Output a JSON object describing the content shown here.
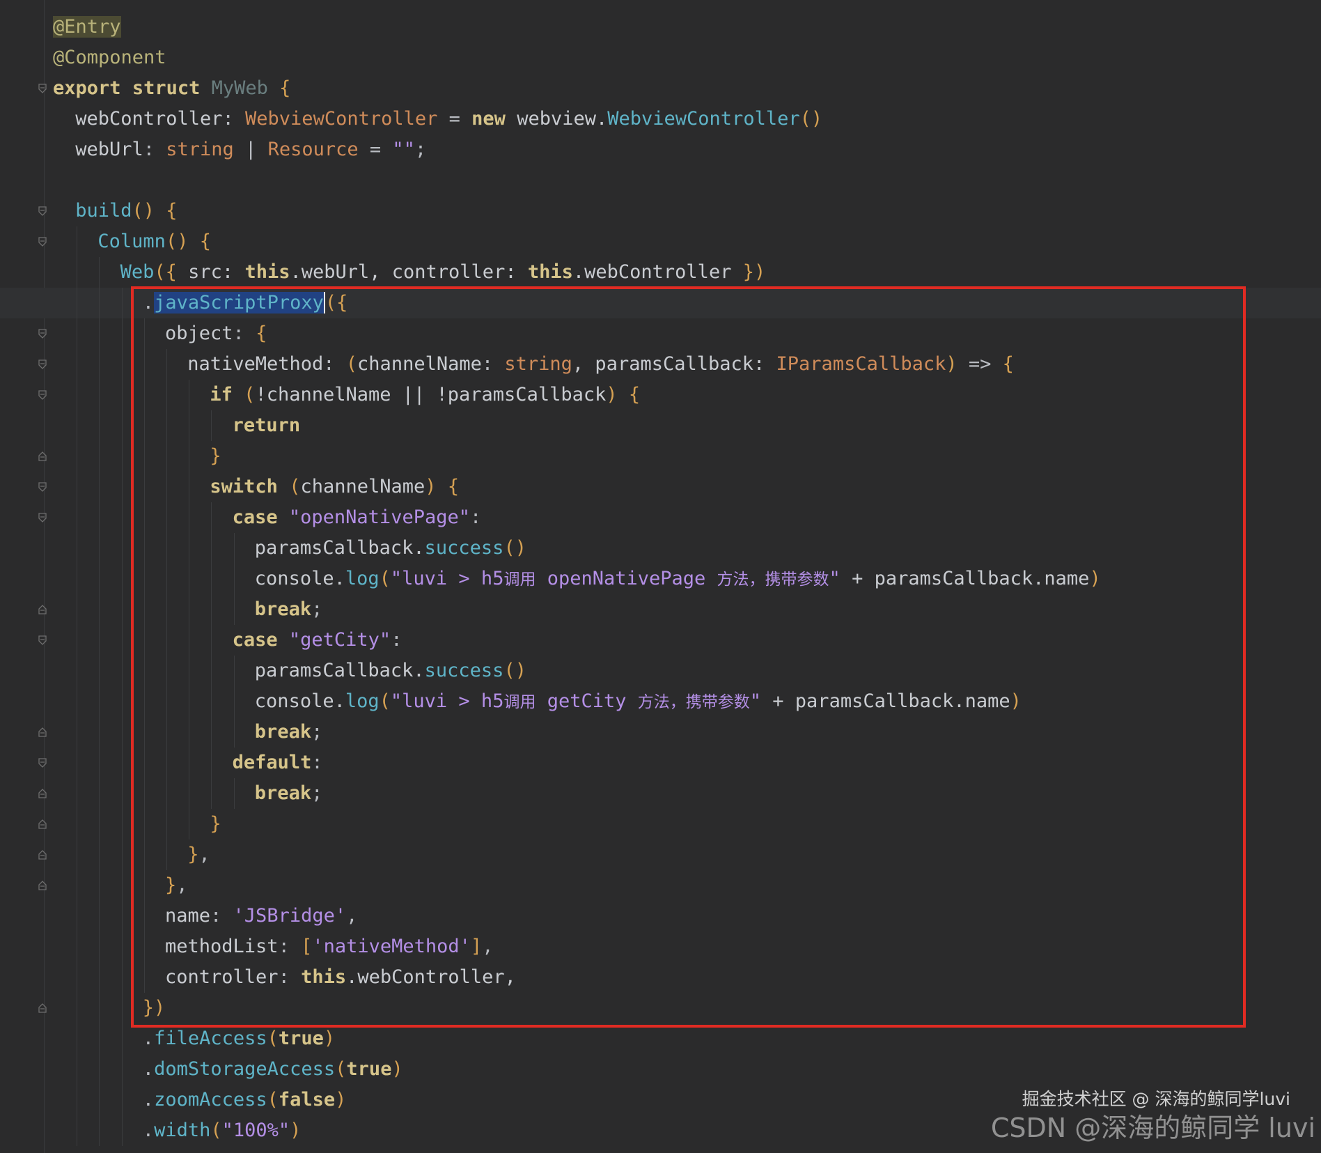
{
  "code_lines": [
    {
      "indent": 0,
      "tokens": [
        {
          "t": "@Entry",
          "c": "ann-hl"
        }
      ]
    },
    {
      "indent": 0,
      "tokens": [
        {
          "t": "@Component",
          "c": "ann"
        }
      ]
    },
    {
      "indent": 0,
      "tokens": [
        {
          "t": "export",
          "c": "kw"
        },
        {
          "t": " ",
          "c": "plain"
        },
        {
          "t": "struct",
          "c": "kw"
        },
        {
          "t": " ",
          "c": "plain"
        },
        {
          "t": "MyWeb",
          "c": "dim"
        },
        {
          "t": " ",
          "c": "plain"
        },
        {
          "t": "{",
          "c": "br"
        }
      ]
    },
    {
      "indent": 1,
      "tokens": [
        {
          "t": "webController",
          "c": "plain"
        },
        {
          "t": ": ",
          "c": "punct"
        },
        {
          "t": "WebviewController",
          "c": "type"
        },
        {
          "t": " = ",
          "c": "punct"
        },
        {
          "t": "new",
          "c": "kw"
        },
        {
          "t": " webview.",
          "c": "plain"
        },
        {
          "t": "WebviewController",
          "c": "fn"
        },
        {
          "t": "()",
          "c": "br"
        }
      ]
    },
    {
      "indent": 1,
      "tokens": [
        {
          "t": "webUrl",
          "c": "plain"
        },
        {
          "t": ": ",
          "c": "punct"
        },
        {
          "t": "string",
          "c": "type"
        },
        {
          "t": " | ",
          "c": "punct"
        },
        {
          "t": "Resource",
          "c": "type"
        },
        {
          "t": " = ",
          "c": "punct"
        },
        {
          "t": "\"\"",
          "c": "str"
        },
        {
          "t": ";",
          "c": "punct"
        }
      ]
    },
    {
      "indent": 0,
      "tokens": []
    },
    {
      "indent": 1,
      "tokens": [
        {
          "t": "build",
          "c": "fn"
        },
        {
          "t": "()",
          "c": "br"
        },
        {
          "t": " ",
          "c": "plain"
        },
        {
          "t": "{",
          "c": "br"
        }
      ]
    },
    {
      "indent": 2,
      "tokens": [
        {
          "t": "Column",
          "c": "fn"
        },
        {
          "t": "()",
          "c": "br"
        },
        {
          "t": " ",
          "c": "plain"
        },
        {
          "t": "{",
          "c": "br"
        }
      ]
    },
    {
      "indent": 3,
      "tokens": [
        {
          "t": "Web",
          "c": "fn"
        },
        {
          "t": "({",
          "c": "br"
        },
        {
          "t": " src: ",
          "c": "plain"
        },
        {
          "t": "this",
          "c": "kw"
        },
        {
          "t": ".webUrl, controller: ",
          "c": "plain"
        },
        {
          "t": "this",
          "c": "kw"
        },
        {
          "t": ".webController ",
          "c": "plain"
        },
        {
          "t": "})",
          "c": "br"
        }
      ]
    },
    {
      "indent": 4,
      "current": true,
      "tokens": [
        {
          "t": ".",
          "c": "punct"
        },
        {
          "t": "javaScriptProxy",
          "c": "sel"
        },
        {
          "t": "",
          "c": "caret"
        },
        {
          "t": "({",
          "c": "br"
        }
      ]
    },
    {
      "indent": 5,
      "tokens": [
        {
          "t": "object",
          "c": "plain"
        },
        {
          "t": ": ",
          "c": "punct"
        },
        {
          "t": "{",
          "c": "br"
        }
      ]
    },
    {
      "indent": 6,
      "tokens": [
        {
          "t": "nativeMethod",
          "c": "plain"
        },
        {
          "t": ": ",
          "c": "punct"
        },
        {
          "t": "(",
          "c": "br"
        },
        {
          "t": "channelName",
          "c": "plain"
        },
        {
          "t": ": ",
          "c": "punct"
        },
        {
          "t": "string",
          "c": "type"
        },
        {
          "t": ", paramsCallback: ",
          "c": "plain"
        },
        {
          "t": "IParamsCallback",
          "c": "type"
        },
        {
          "t": ")",
          "c": "br"
        },
        {
          "t": " => ",
          "c": "punct"
        },
        {
          "t": "{",
          "c": "br"
        }
      ]
    },
    {
      "indent": 7,
      "tokens": [
        {
          "t": "if",
          "c": "kw"
        },
        {
          "t": " ",
          "c": "plain"
        },
        {
          "t": "(",
          "c": "br"
        },
        {
          "t": "!channelName || !paramsCallback",
          "c": "plain"
        },
        {
          "t": ")",
          "c": "br"
        },
        {
          "t": " ",
          "c": "plain"
        },
        {
          "t": "{",
          "c": "br"
        }
      ]
    },
    {
      "indent": 8,
      "tokens": [
        {
          "t": "return",
          "c": "kw"
        }
      ]
    },
    {
      "indent": 7,
      "tokens": [
        {
          "t": "}",
          "c": "br"
        }
      ]
    },
    {
      "indent": 7,
      "tokens": [
        {
          "t": "switch",
          "c": "kw"
        },
        {
          "t": " ",
          "c": "plain"
        },
        {
          "t": "(",
          "c": "br"
        },
        {
          "t": "channelName",
          "c": "plain"
        },
        {
          "t": ")",
          "c": "br"
        },
        {
          "t": " ",
          "c": "plain"
        },
        {
          "t": "{",
          "c": "br"
        }
      ]
    },
    {
      "indent": 8,
      "tokens": [
        {
          "t": "case",
          "c": "kw"
        },
        {
          "t": " ",
          "c": "plain"
        },
        {
          "t": "\"openNativePage\"",
          "c": "str"
        },
        {
          "t": ":",
          "c": "punct"
        }
      ]
    },
    {
      "indent": 9,
      "tokens": [
        {
          "t": "paramsCallback.",
          "c": "plain"
        },
        {
          "t": "success",
          "c": "fn"
        },
        {
          "t": "()",
          "c": "br"
        }
      ]
    },
    {
      "indent": 9,
      "tokens": [
        {
          "t": "console.",
          "c": "plain"
        },
        {
          "t": "log",
          "c": "fn"
        },
        {
          "t": "(",
          "c": "br"
        },
        {
          "t": "\"luvi > h5",
          "c": "str"
        },
        {
          "t": "调用",
          "c": "cjk"
        },
        {
          "t": " openNativePage ",
          "c": "str"
        },
        {
          "t": "方法，携带参数",
          "c": "cjk"
        },
        {
          "t": "\"",
          "c": "str"
        },
        {
          "t": " + paramsCallback.name",
          "c": "plain"
        },
        {
          "t": ")",
          "c": "br"
        }
      ]
    },
    {
      "indent": 9,
      "tokens": [
        {
          "t": "break",
          "c": "kw"
        },
        {
          "t": ";",
          "c": "punct"
        }
      ]
    },
    {
      "indent": 8,
      "tokens": [
        {
          "t": "case",
          "c": "kw"
        },
        {
          "t": " ",
          "c": "plain"
        },
        {
          "t": "\"getCity\"",
          "c": "str"
        },
        {
          "t": ":",
          "c": "punct"
        }
      ]
    },
    {
      "indent": 9,
      "tokens": [
        {
          "t": "paramsCallback.",
          "c": "plain"
        },
        {
          "t": "success",
          "c": "fn"
        },
        {
          "t": "()",
          "c": "br"
        }
      ]
    },
    {
      "indent": 9,
      "tokens": [
        {
          "t": "console.",
          "c": "plain"
        },
        {
          "t": "log",
          "c": "fn"
        },
        {
          "t": "(",
          "c": "br"
        },
        {
          "t": "\"luvi > h5",
          "c": "str"
        },
        {
          "t": "调用",
          "c": "cjk"
        },
        {
          "t": " getCity ",
          "c": "str"
        },
        {
          "t": "方法，携带参数",
          "c": "cjk"
        },
        {
          "t": "\"",
          "c": "str"
        },
        {
          "t": " + paramsCallback.name",
          "c": "plain"
        },
        {
          "t": ")",
          "c": "br"
        }
      ]
    },
    {
      "indent": 9,
      "tokens": [
        {
          "t": "break",
          "c": "kw"
        },
        {
          "t": ";",
          "c": "punct"
        }
      ]
    },
    {
      "indent": 8,
      "tokens": [
        {
          "t": "default",
          "c": "kw"
        },
        {
          "t": ":",
          "c": "punct"
        }
      ]
    },
    {
      "indent": 9,
      "tokens": [
        {
          "t": "break",
          "c": "kw"
        },
        {
          "t": ";",
          "c": "punct"
        }
      ]
    },
    {
      "indent": 7,
      "tokens": [
        {
          "t": "}",
          "c": "br"
        }
      ]
    },
    {
      "indent": 6,
      "tokens": [
        {
          "t": "}",
          "c": "br"
        },
        {
          "t": ",",
          "c": "punct"
        }
      ]
    },
    {
      "indent": 5,
      "tokens": [
        {
          "t": "}",
          "c": "br"
        },
        {
          "t": ",",
          "c": "punct"
        }
      ]
    },
    {
      "indent": 5,
      "tokens": [
        {
          "t": "name",
          "c": "plain"
        },
        {
          "t": ": ",
          "c": "punct"
        },
        {
          "t": "'JSBridge'",
          "c": "str"
        },
        {
          "t": ",",
          "c": "punct"
        }
      ]
    },
    {
      "indent": 5,
      "tokens": [
        {
          "t": "methodList",
          "c": "plain"
        },
        {
          "t": ": ",
          "c": "punct"
        },
        {
          "t": "[",
          "c": "br"
        },
        {
          "t": "'nativeMethod'",
          "c": "str"
        },
        {
          "t": "]",
          "c": "br"
        },
        {
          "t": ",",
          "c": "punct"
        }
      ]
    },
    {
      "indent": 5,
      "tokens": [
        {
          "t": "controller",
          "c": "plain"
        },
        {
          "t": ": ",
          "c": "punct"
        },
        {
          "t": "this",
          "c": "kw"
        },
        {
          "t": ".webController,",
          "c": "plain"
        }
      ]
    },
    {
      "indent": 4,
      "tokens": [
        {
          "t": "})",
          "c": "br"
        }
      ]
    },
    {
      "indent": 4,
      "tokens": [
        {
          "t": ".",
          "c": "punct"
        },
        {
          "t": "fileAccess",
          "c": "fn"
        },
        {
          "t": "(",
          "c": "br"
        },
        {
          "t": "true",
          "c": "kw"
        },
        {
          "t": ")",
          "c": "br"
        }
      ]
    },
    {
      "indent": 4,
      "tokens": [
        {
          "t": ".",
          "c": "punct"
        },
        {
          "t": "domStorageAccess",
          "c": "fn"
        },
        {
          "t": "(",
          "c": "br"
        },
        {
          "t": "true",
          "c": "kw"
        },
        {
          "t": ")",
          "c": "br"
        }
      ]
    },
    {
      "indent": 4,
      "tokens": [
        {
          "t": ".",
          "c": "punct"
        },
        {
          "t": "zoomAccess",
          "c": "fn"
        },
        {
          "t": "(",
          "c": "br"
        },
        {
          "t": "false",
          "c": "kw"
        },
        {
          "t": ")",
          "c": "br"
        }
      ]
    },
    {
      "indent": 4,
      "tokens": [
        {
          "t": ".",
          "c": "punct"
        },
        {
          "t": "width",
          "c": "fn"
        },
        {
          "t": "(",
          "c": "br"
        },
        {
          "t": "\"100%\"",
          "c": "str"
        },
        {
          "t": ")",
          "c": "br"
        }
      ]
    }
  ],
  "fold_icons": [
    {
      "line": 2,
      "icon": "fold-open-icon"
    },
    {
      "line": 6,
      "icon": "fold-open-icon"
    },
    {
      "line": 7,
      "icon": "fold-open-icon"
    },
    {
      "line": 9,
      "icon": "fold-open-icon"
    },
    {
      "line": 10,
      "icon": "fold-open-icon"
    },
    {
      "line": 11,
      "icon": "fold-open-icon"
    },
    {
      "line": 12,
      "icon": "fold-open-icon"
    },
    {
      "line": 14,
      "icon": "fold-close-icon"
    },
    {
      "line": 15,
      "icon": "fold-open-icon"
    },
    {
      "line": 16,
      "icon": "fold-open-icon"
    },
    {
      "line": 19,
      "icon": "fold-close-icon"
    },
    {
      "line": 20,
      "icon": "fold-open-icon"
    },
    {
      "line": 23,
      "icon": "fold-close-icon"
    },
    {
      "line": 24,
      "icon": "fold-open-icon"
    },
    {
      "line": 25,
      "icon": "fold-close-icon"
    },
    {
      "line": 26,
      "icon": "fold-close-icon"
    },
    {
      "line": 27,
      "icon": "fold-close-icon"
    },
    {
      "line": 28,
      "icon": "fold-close-icon"
    },
    {
      "line": 32,
      "icon": "fold-close-icon"
    }
  ],
  "colors": {
    "background": "#2b2b2c",
    "highlight_box": "#e02b23",
    "selection": "#214283"
  },
  "watermark": {
    "line1": "掘金技术社区 @ 深海的鲸同学luvi",
    "line2": "CSDN @深海的鲸同学 luvi"
  }
}
